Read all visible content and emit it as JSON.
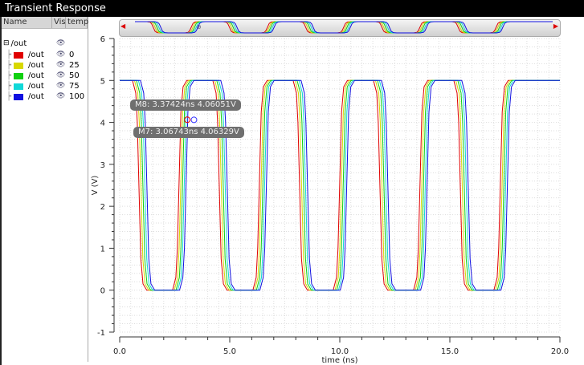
{
  "window": {
    "title": "Transient Response"
  },
  "tree": {
    "headers": [
      "Name",
      "Vis",
      "temp"
    ],
    "root": "/out",
    "items": [
      {
        "label": "/out",
        "temp": "0",
        "color": "#e00000"
      },
      {
        "label": "/out",
        "temp": "25",
        "color": "#d8d800"
      },
      {
        "label": "/out",
        "temp": "50",
        "color": "#10d010"
      },
      {
        "label": "/out",
        "temp": "75",
        "color": "#10d8d8"
      },
      {
        "label": "/out",
        "temp": "100",
        "color": "#1010e0"
      }
    ]
  },
  "markers": [
    {
      "label": "M8: 3.37424ns 4.06051V",
      "x": 3.37424,
      "y": 4.06051
    },
    {
      "label": "M7: 3.06743ns 4.06329V",
      "x": 3.06743,
      "y": 4.06329
    }
  ],
  "chart_data": {
    "type": "line",
    "xlabel": "time (ns)",
    "ylabel": "V (V)",
    "xlim": [
      0,
      20
    ],
    "ylim": [
      -1,
      6
    ],
    "grid": true,
    "xticks": [
      "0.0",
      "5.0",
      "10.0",
      "15.0",
      "20.0"
    ],
    "yticks": [
      "-1",
      "0",
      "1",
      "2",
      "3",
      "4",
      "5",
      "6"
    ],
    "levels": {
      "high": 5,
      "low": 0
    },
    "series": [
      {
        "name": "/out temp=0",
        "color": "#e00000",
        "fall_edges_ns": [
          0.88,
          4.53,
          8.18,
          11.83,
          15.48
        ],
        "rise_edges_ns": [
          2.7,
          6.35,
          10.0,
          13.65,
          17.3
        ]
      },
      {
        "name": "/out temp=25",
        "color": "#d8d800",
        "fall_edges_ns": [
          0.97,
          4.62,
          8.27,
          11.92,
          15.57
        ],
        "rise_edges_ns": [
          2.78,
          6.43,
          10.08,
          13.73,
          17.38
        ]
      },
      {
        "name": "/out temp=50",
        "color": "#10d010",
        "fall_edges_ns": [
          1.06,
          4.71,
          8.36,
          12.01,
          15.66
        ],
        "rise_edges_ns": [
          2.86,
          6.51,
          10.16,
          13.81,
          17.46
        ]
      },
      {
        "name": "/out temp=75",
        "color": "#10d8d8",
        "fall_edges_ns": [
          1.15,
          4.8,
          8.45,
          12.1,
          15.75
        ],
        "rise_edges_ns": [
          2.94,
          6.59,
          10.24,
          13.89,
          17.54
        ]
      },
      {
        "name": "/out temp=100",
        "color": "#1010e0",
        "fall_edges_ns": [
          1.24,
          4.89,
          8.54,
          12.19,
          15.84
        ],
        "rise_edges_ns": [
          3.02,
          6.67,
          10.32,
          13.97,
          17.62
        ]
      }
    ]
  }
}
